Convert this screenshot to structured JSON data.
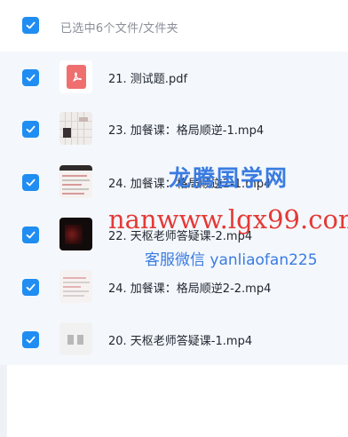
{
  "header": {
    "title": "已选中6个文件/文件夹",
    "checked": true
  },
  "files": [
    {
      "name": "21. 测试题.pdf",
      "thumb": "pdf-icon",
      "checked": true
    },
    {
      "name": "23. 加餐课：格局顺逆-1.mp4",
      "thumb": "video-thumbnail",
      "checked": true
    },
    {
      "name": "24. 加餐课：格局顺逆2-1.mp4",
      "thumb": "video-thumbnail",
      "checked": true
    },
    {
      "name": "22. 天枢老师答疑课-2.mp4",
      "thumb": "video-thumbnail",
      "checked": true
    },
    {
      "name": "24. 加餐课：格局顺逆2-2.mp4",
      "thumb": "video-thumbnail",
      "checked": true
    },
    {
      "name": "20. 天枢老师答疑课-1.mp4",
      "thumb": "video-thumbnail",
      "checked": true
    }
  ],
  "watermark": {
    "line1": "龙腾国学网",
    "line2": "nanwww.lgx99.com",
    "line3": "客服微信 yanliaofan225"
  },
  "colors": {
    "accent": "#1f8df2",
    "list_background": "#f4f8fd",
    "watermark_blue": "#3a7be0",
    "watermark_red": "#e53935"
  }
}
